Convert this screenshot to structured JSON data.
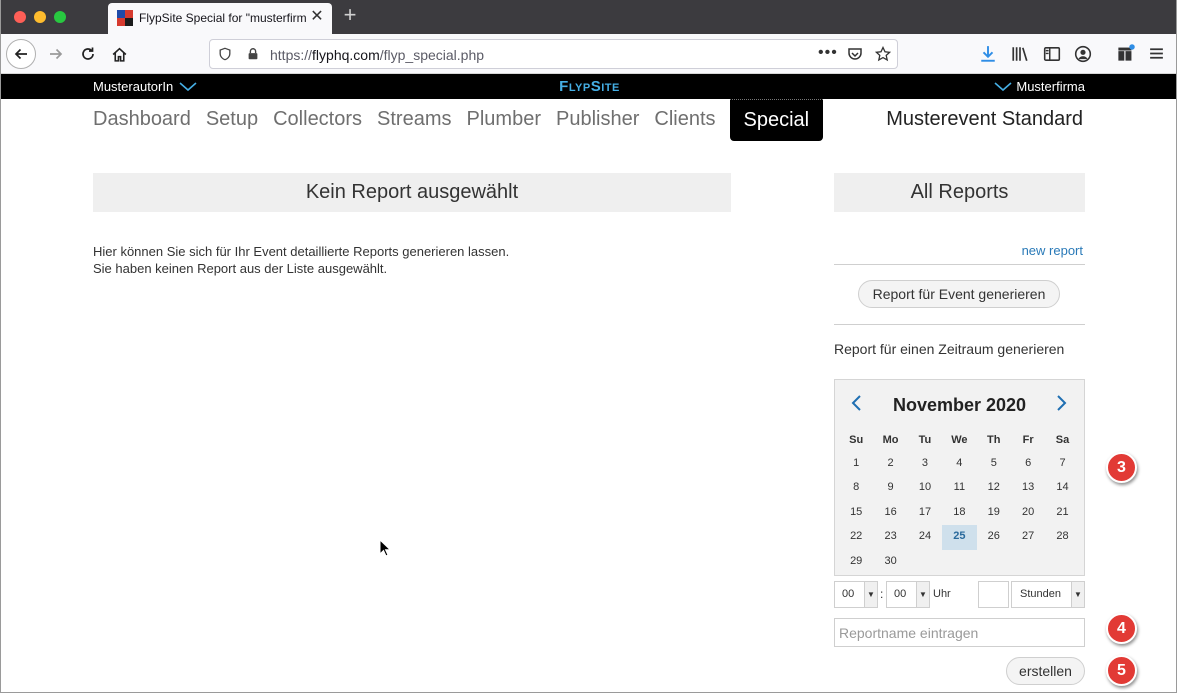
{
  "browser": {
    "tab_title": "FlypSite Special for \"musterfirma\"",
    "url_prefix": "https://",
    "url_host": "flyphq.com",
    "url_path": "/flyp_special.php"
  },
  "topbar": {
    "user": "MusterautorIn",
    "brand": "FlypSite",
    "company": "Musterfirma"
  },
  "nav": {
    "items": [
      "Dashboard",
      "Setup",
      "Collectors",
      "Streams",
      "Plumber",
      "Publisher",
      "Clients",
      "Special"
    ],
    "active": "Special",
    "event": "Musterevent Standard"
  },
  "left": {
    "heading": "Kein Report ausgewählt",
    "line1": "Hier können Sie sich für Ihr Event detaillierte Reports generieren lassen.",
    "line2": "Sie haben keinen Report aus der Liste ausgewählt."
  },
  "right": {
    "heading": "All Reports",
    "new_report": "new report",
    "event_button": "Report für Event generieren",
    "range_label": "Report für einen Zeitraum generieren"
  },
  "calendar": {
    "month": "November 2020",
    "weekdays": [
      "Su",
      "Mo",
      "Tu",
      "We",
      "Th",
      "Fr",
      "Sa"
    ],
    "weeks": [
      [
        "1",
        "2",
        "3",
        "4",
        "5",
        "6",
        "7"
      ],
      [
        "8",
        "9",
        "10",
        "11",
        "12",
        "13",
        "14"
      ],
      [
        "15",
        "16",
        "17",
        "18",
        "19",
        "20",
        "21"
      ],
      [
        "22",
        "23",
        "24",
        "25",
        "26",
        "27",
        "28"
      ],
      [
        "29",
        "30",
        "",
        "",
        "",
        "",
        ""
      ]
    ],
    "selected": "25"
  },
  "time": {
    "hour": "00",
    "minute": "00",
    "uhr": "Uhr",
    "unit": "Stunden"
  },
  "report_name_placeholder": "Reportname eintragen",
  "create_button": "erstellen",
  "badges": [
    "3",
    "4",
    "5"
  ],
  "colors": {
    "accent": "#45aee4",
    "link": "#2a7ab8",
    "badge": "#e23a35"
  }
}
